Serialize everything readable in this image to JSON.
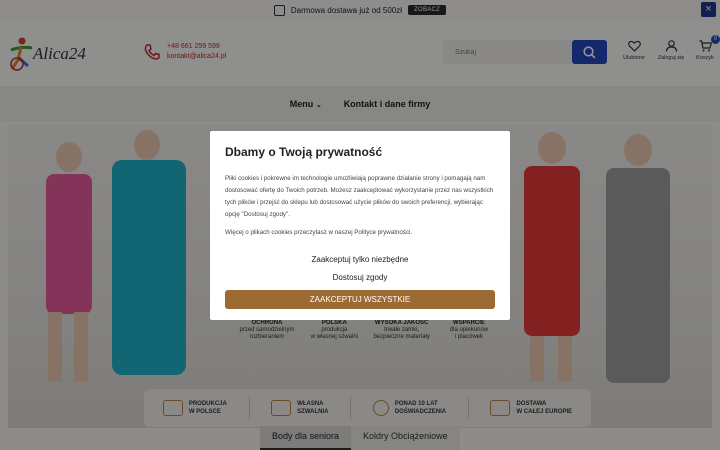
{
  "topbar": {
    "text": "Darmowa dostawa już od 500zł",
    "cta": "ZOBACZ",
    "close": "×"
  },
  "header": {
    "logo_text": "Alica24",
    "phone": "+48 661 259 599",
    "email": "kontakt@alica24.pl",
    "search_placeholder": "Szukaj",
    "icons": [
      {
        "name": "heart-icon",
        "label": "Ulubione"
      },
      {
        "name": "user-icon",
        "label": "Zaloguj się"
      },
      {
        "name": "cart-icon",
        "label": "Koszyk",
        "badge": "0"
      }
    ]
  },
  "nav": {
    "menu": "Menu",
    "contact": "Kontakt i dane firmy"
  },
  "hero": {
    "features": [
      {
        "title": "OCHRONA",
        "line1": "przed samodzielnym",
        "line2": "rozbieraniem"
      },
      {
        "title": "POLSKA",
        "line1": "produkcja",
        "line2": "w własnej szwalni"
      },
      {
        "title": "WYSOKA JAKOŚĆ",
        "line1": "trwałe zamki,",
        "line2": "bezpieczne materiały"
      },
      {
        "title": "WSPARCIE",
        "line1": "dla opiekunów",
        "line2": "i placówek"
      }
    ],
    "strip": [
      {
        "l1": "PRODUKCJA",
        "l2": "W POLSCE"
      },
      {
        "l1": "WŁASNA",
        "l2": "SZWALNIA"
      },
      {
        "l1": "PONAD 10 LAT",
        "l2": "DOŚWIADCZENIA"
      },
      {
        "l1": "DOSTAWA",
        "l2": "W CAŁEJ EUROPIE"
      }
    ]
  },
  "tabs": {
    "active": "Body dla seniora",
    "inactive": "Koldry Obciążeniowe"
  },
  "modal": {
    "title": "Dbamy o Twoją prywatność",
    "body": "Pliki cookies i pokrewne im technologie umożliwiają poprawne działanie strony i pomagają nam dostosować ofertę do Twoich potrzeb. Możesz zaakceptować wykorzystanie przez nas wszystkich tych plików i przejść do sklepu lub dostosować użycie plików do swoich preferencji, wybierając opcję \"Dostosuj zgody\".",
    "more": "Więcej o plikach cookies przeczytasz w naszej Polityce prywatności.",
    "btn_necessary": "Zaakceptuj tylko niezbędne",
    "btn_customize": "Dostosuj zgody",
    "btn_accept_all": "ZAAKCEPTUJ WSZYSTKIE"
  },
  "colors": {
    "accent": "#2148b8",
    "brand_brown": "#9c6b33",
    "phone_red": "#c0262d"
  }
}
